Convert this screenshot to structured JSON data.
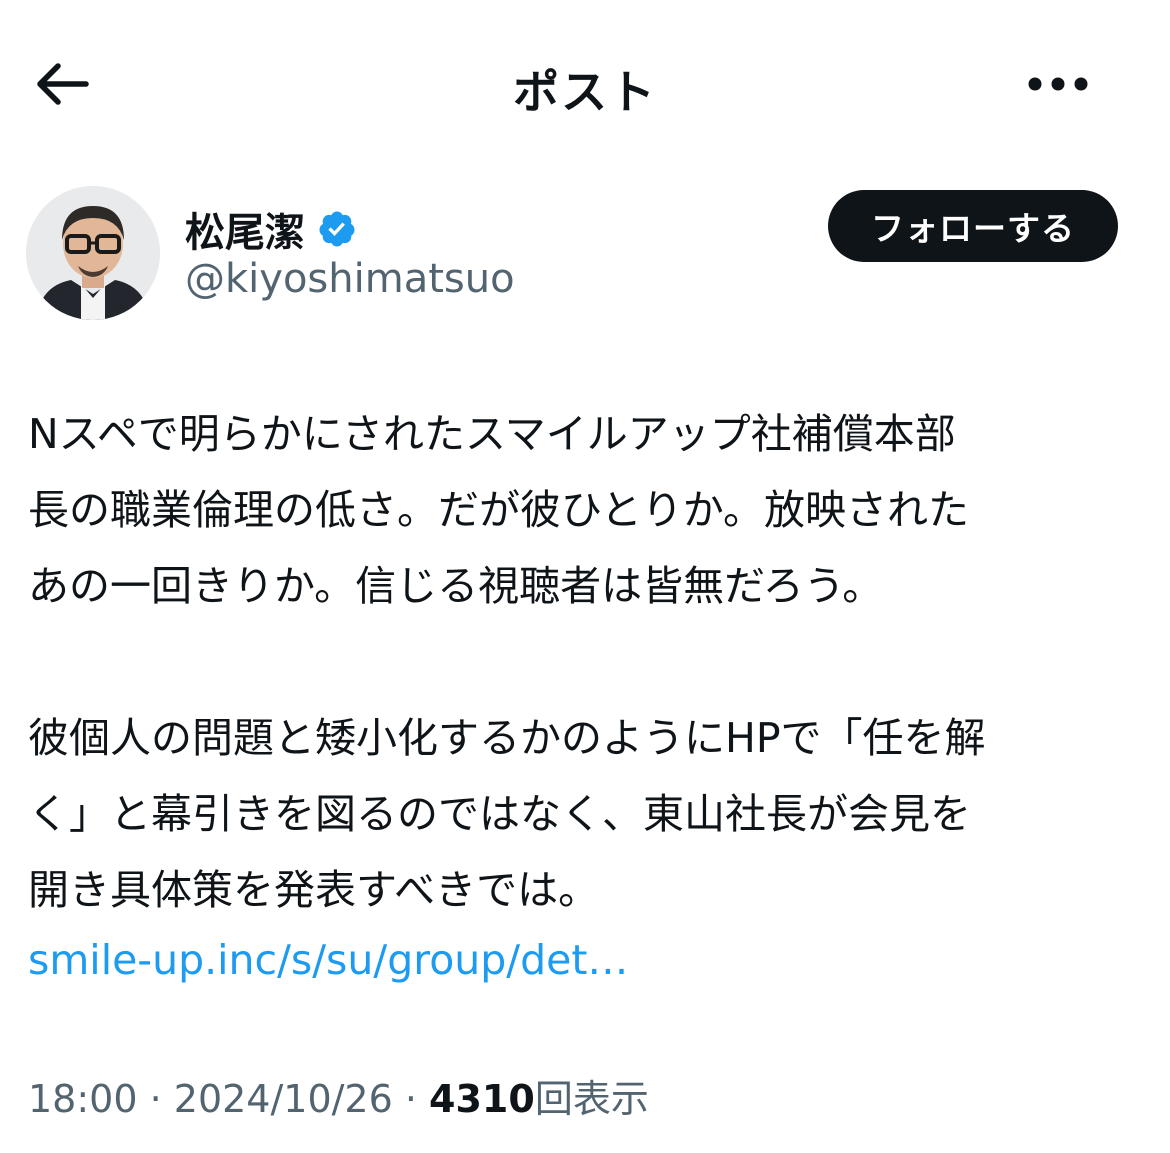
{
  "header": {
    "title": "ポスト"
  },
  "author": {
    "name": "松尾潔",
    "handle": "@kiyoshimatsuo",
    "verified": true,
    "verified_color": "#1d9bf0"
  },
  "follow_button_label": "フォローする",
  "post": {
    "lines": [
      "Nスペで明らかにされたスマイルアップ社補償本部",
      "長の職業倫理の低さ。だが彼ひとりか。放映された",
      "あの一回きりか。信じる視聴者は皆無だろう。",
      "",
      "彼個人の問題と矮小化するかのようにHPで「任を解",
      "く」と幕引きを図るのではなく、東山社長が会見を",
      "開き具体策を発表すべきでは。"
    ],
    "link": "smile-up.inc/s/su/group/det…"
  },
  "meta": {
    "time": "18:00",
    "sep1": " · ",
    "date": "2024/10/26",
    "sep2": " · ",
    "views_count": "4310",
    "views_label": "回表示"
  },
  "icons": {
    "back": "back-arrow-icon",
    "more": "more-horizontal-icon",
    "verified": "verified-badge-icon"
  },
  "colors": {
    "text": "#0f1419",
    "secondary": "#536471",
    "link": "#1d9bf0",
    "button_bg": "#0f1419"
  }
}
